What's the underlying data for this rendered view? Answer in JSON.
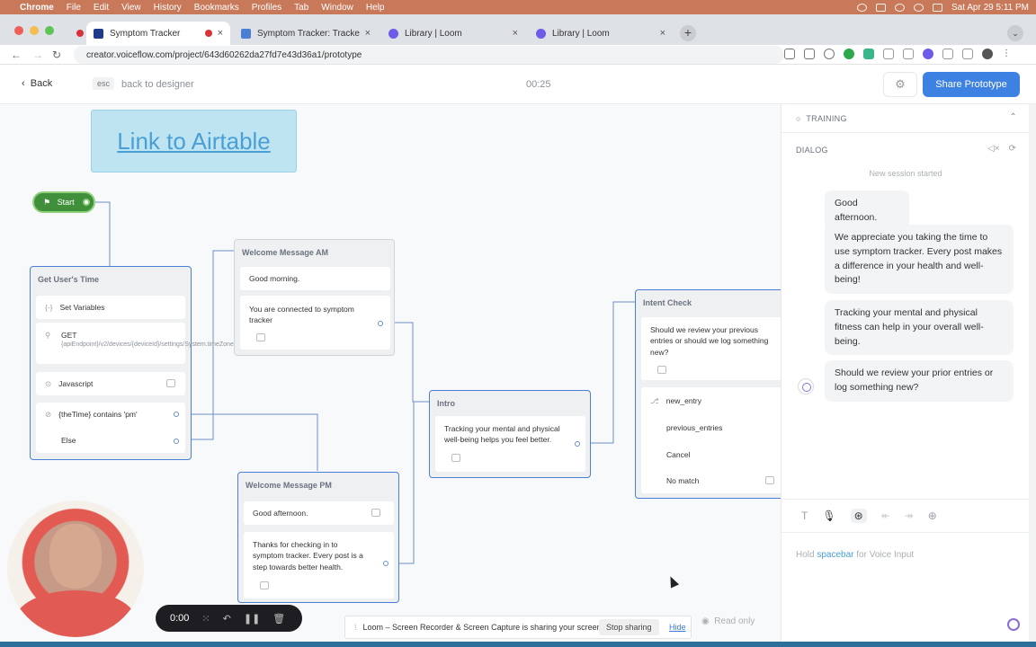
{
  "menubar": {
    "app": "Chrome",
    "items": [
      "File",
      "Edit",
      "View",
      "History",
      "Bookmarks",
      "Profiles",
      "Tab",
      "Window",
      "Help"
    ],
    "clock": "Sat Apr 29  5:11 PM"
  },
  "tabs": [
    {
      "title": "Symptom Tracker",
      "color": "#1f3a8a",
      "active": true,
      "recording": true
    },
    {
      "title": "Symptom Tracker: Tracker - Ai",
      "color": "#4a7fd4",
      "active": false
    },
    {
      "title": "Library | Loom",
      "color": "#6c5ce7",
      "active": false
    },
    {
      "title": "Library | Loom",
      "color": "#6c5ce7",
      "active": false
    }
  ],
  "address": {
    "url": "creator.voiceflow.com/project/643d60262da27fd7e43d36a1/prototype"
  },
  "header": {
    "back_label": "Back",
    "esc_label": "esc",
    "back_designer_label": "back to designer",
    "timer": "00:25",
    "share_label": "Share Prototype",
    "accent": "#3d82e2"
  },
  "canvas": {
    "airtable_link": "Link to Airtable",
    "start_label": "Start",
    "get_time": {
      "title": "Get User's Time",
      "set_variables": "Set Variables",
      "get_label": "GET",
      "get_url": "{apiEndpoint}/v2/devices/{deviceId}/settings/System.timeZone",
      "javascript": "Javascript",
      "condition": "{theTime} contains 'pm'",
      "else_label": "Else"
    },
    "welcome_am": {
      "title": "Welcome Message AM",
      "line1": "Good morning.",
      "line2": "You are connected to symptom tracker"
    },
    "welcome_pm": {
      "title": "Welcome Message PM",
      "line1": "Good afternoon.",
      "line2": "Thanks for checking in to symptom tracker. Every post is a step towards better health."
    },
    "intro": {
      "title": "Intro",
      "line1": "Tracking your mental and physical well-being helps you feel better."
    },
    "intent_check": {
      "title": "Intent Check",
      "prompt": "Should we review your previous entries  or should we log something new?",
      "choices": [
        "new_entry",
        "previous_entries",
        "Cancel",
        "No match"
      ]
    },
    "read_only": "Read only",
    "loom_banner": {
      "message": "Loom – Screen Recorder & Screen Capture is sharing your screen.",
      "stop_label": "Stop sharing",
      "hide_label": "Hide"
    },
    "rec_timer": "0:00"
  },
  "panel": {
    "training_label": "TRAINING",
    "dialog_label": "DIALOG",
    "session_started": "New session started",
    "messages": [
      "Good afternoon.",
      "We appreciate you taking the time to use symptom tracker. Every post makes a difference in your health and well-being!",
      "Tracking your mental and physical fitness can help in your overall well-being.",
      "Should we review your prior entries or log something new?"
    ],
    "hold_prefix": "Hold ",
    "hold_key": "spacebar",
    "hold_suffix": " for Voice Input"
  }
}
